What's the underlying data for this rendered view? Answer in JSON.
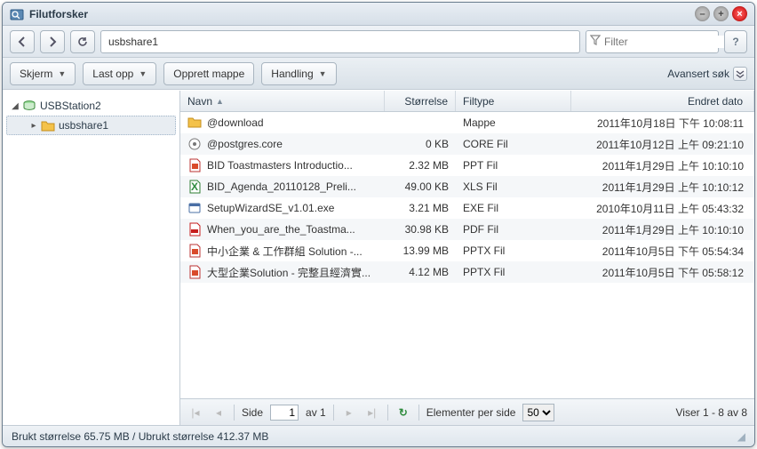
{
  "window": {
    "title": "Filutforsker"
  },
  "nav": {
    "path": "usbshare1",
    "filter_placeholder": "Filter"
  },
  "toolbar": {
    "screen": "Skjerm",
    "upload": "Last opp",
    "create_folder": "Opprett mappe",
    "action": "Handling",
    "advanced_search": "Avansert søk"
  },
  "tree": {
    "root": "USBStation2",
    "child": "usbshare1"
  },
  "columns": {
    "name": "Navn",
    "size": "Størrelse",
    "type": "Filtype",
    "date": "Endret dato"
  },
  "files": [
    {
      "icon": "folder",
      "name": "@download",
      "size": "",
      "type": "Mappe",
      "date": "2011年10月18日 下午 10:08:11"
    },
    {
      "icon": "core",
      "name": "@postgres.core",
      "size": "0 KB",
      "type": "CORE Fil",
      "date": "2011年10月12日 上午 09:21:10"
    },
    {
      "icon": "ppt",
      "name": "BID Toastmasters Introductio...",
      "size": "2.32 MB",
      "type": "PPT Fil",
      "date": "2011年1月29日 上午 10:10:10"
    },
    {
      "icon": "xls",
      "name": "BID_Agenda_20110128_Preli...",
      "size": "49.00 KB",
      "type": "XLS Fil",
      "date": "2011年1月29日 上午 10:10:12"
    },
    {
      "icon": "exe",
      "name": "SetupWizardSE_v1.01.exe",
      "size": "3.21 MB",
      "type": "EXE Fil",
      "date": "2010年10月11日 上午 05:43:32"
    },
    {
      "icon": "pdf",
      "name": "When_you_are_the_Toastma...",
      "size": "30.98 KB",
      "type": "PDF Fil",
      "date": "2011年1月29日 上午 10:10:10"
    },
    {
      "icon": "pptx",
      "name": "中小企業 & 工作群組 Solution -...",
      "size": "13.99 MB",
      "type": "PPTX Fil",
      "date": "2011年10月5日 下午 05:54:34"
    },
    {
      "icon": "pptx",
      "name": "大型企業Solution - 完整且經濟實...",
      "size": "4.12 MB",
      "type": "PPTX Fil",
      "date": "2011年10月5日 下午 05:58:12"
    }
  ],
  "pager": {
    "side_label": "Side",
    "current": "1",
    "of_label": "av 1",
    "per_page_label": "Elementer per side",
    "per_page_value": "50",
    "showing": "Viser 1 - 8 av 8"
  },
  "status": {
    "text": "Brukt størrelse 65.75 MB / Ubrukt størrelse 412.37 MB"
  },
  "icons": {
    "folder_color": "#f4c24a",
    "ppt_color": "#d94b2b",
    "xls_color": "#2e8b3d",
    "pdf_color": "#c61d1d",
    "exe_color": "#4a6fa5",
    "core_color": "#777"
  }
}
